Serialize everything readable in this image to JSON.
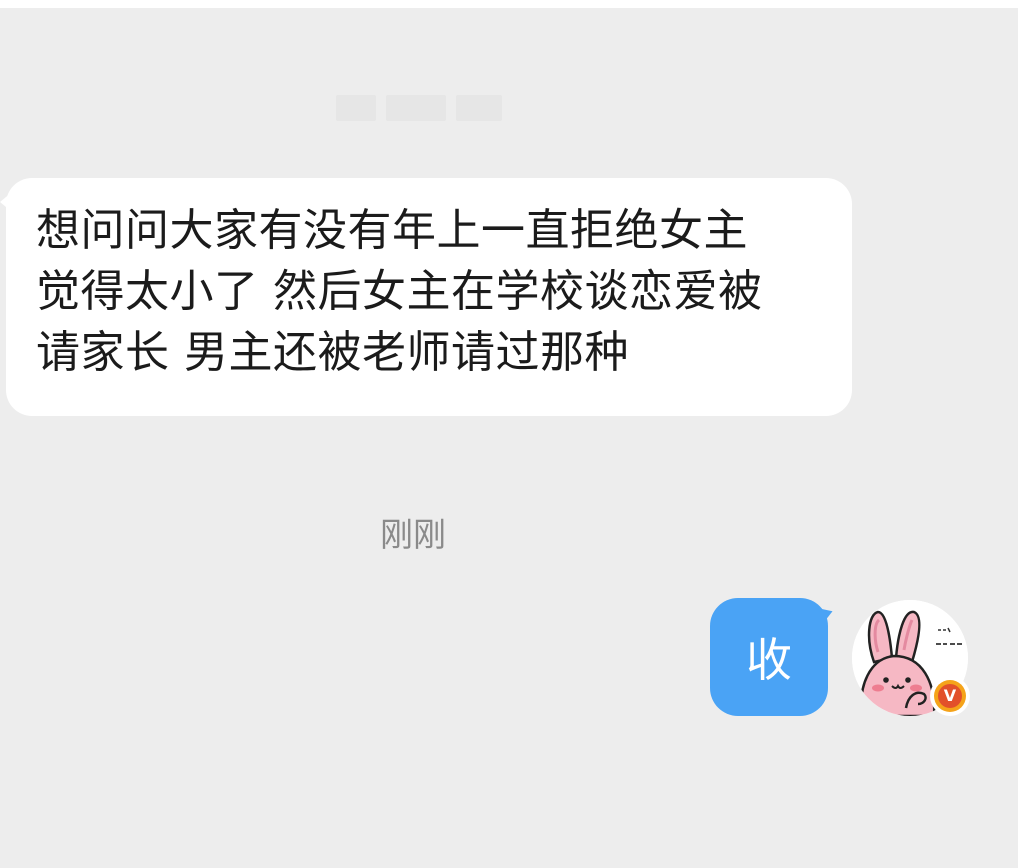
{
  "conversation": {
    "incoming_message": {
      "lines": [
        "想问问大家有没有年上一直拒绝女主",
        "觉得太小了 然后女主在学校谈恋爱被",
        "请家长 男主还被老师请过那种"
      ]
    },
    "timestamp": "刚刚",
    "outgoing_message": {
      "text": "收"
    },
    "avatar": {
      "icon": "pink-bunny-avatar",
      "verified_badge_label": "V"
    }
  },
  "colors": {
    "background": "#ededed",
    "incoming_bubble": "#ffffff",
    "outgoing_bubble": "#4aa3f5",
    "badge_outer": "#f5a31a",
    "badge_inner": "#e2502a"
  }
}
